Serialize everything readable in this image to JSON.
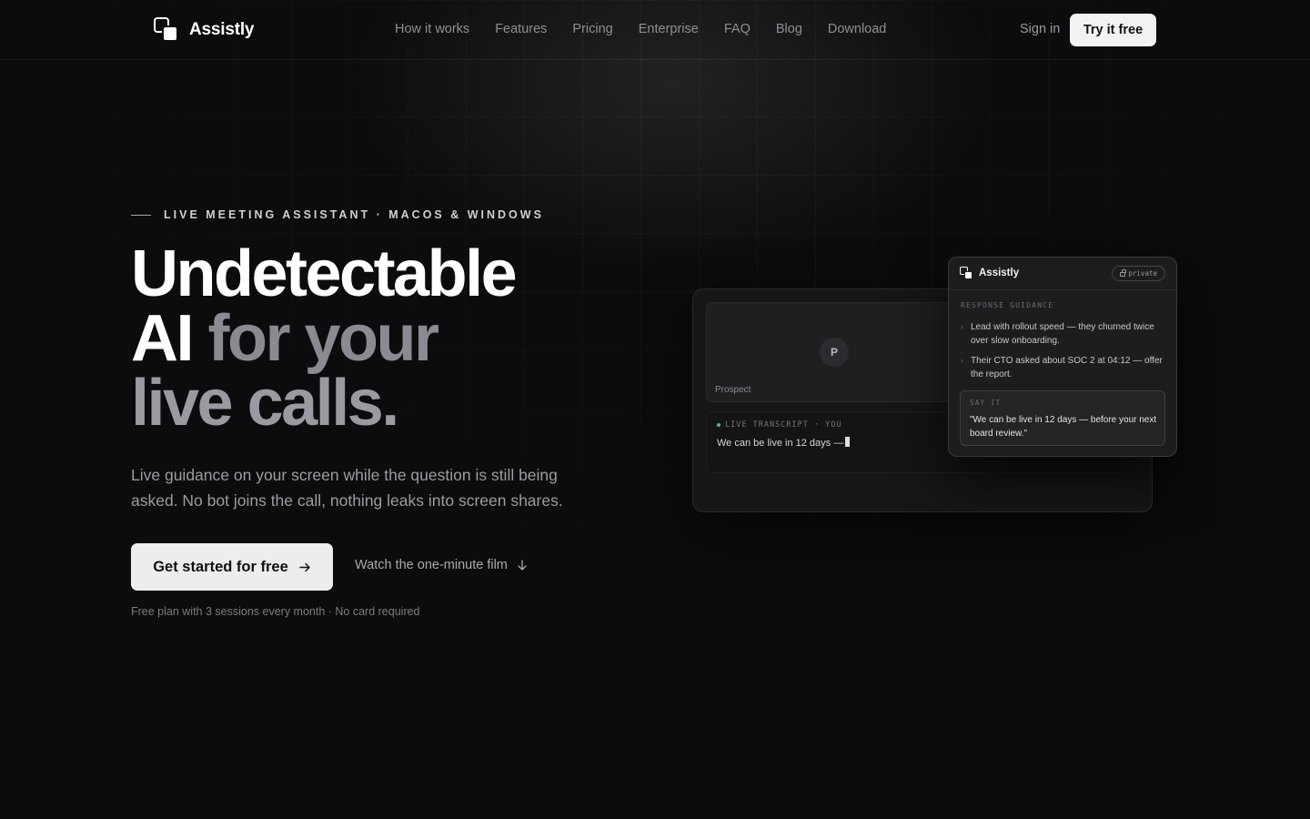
{
  "nav": {
    "brand": "Assistly",
    "links": [
      "How it works",
      "Features",
      "Pricing",
      "Enterprise",
      "FAQ",
      "Blog",
      "Download"
    ],
    "signin": "Sign in",
    "try_free": "Try it free"
  },
  "hero": {
    "eyebrow": "LIVE MEETING ASSISTANT · MACOS & WINDOWS",
    "headline": {
      "line1": "Undetectable",
      "line2a": "AI",
      "line2b": "for your",
      "line3": "live calls."
    },
    "subtitle": "Live guidance on your screen while the question is still being asked. No bot joins the call, nothing leaks into screen shares.",
    "cta_label": "Get started for free",
    "watch_label": "Watch the one-minute film",
    "fine_print": "Free plan with 3 sessions every month · No card required"
  },
  "mockup": {
    "avatar_initial": "P",
    "participant_label": "Prospect",
    "transcript_label": "LIVE TRANSCRIPT · YOU",
    "transcript_text": "We can be live in 12 days —",
    "panel": {
      "brand": "Assistly",
      "badge": "private",
      "section_label": "RESPONSE GUIDANCE",
      "bullets": [
        "Lead with rollout speed — they churned twice over slow onboarding.",
        "Their CTO asked about SOC 2 at 04:12 — offer the report."
      ],
      "say_it_label": "SAY IT",
      "say_it_text": "\"We can be live in 12 days — before your next board review.\""
    }
  },
  "colors": {
    "background": "#0c0c0e",
    "primary_button": "#ededed",
    "muted_text": "#8a8a92",
    "live_dot": "#4fbf7a"
  },
  "icons": {
    "cta": "arrow-right-icon",
    "watch": "arrow-down-icon",
    "badge": "lock-icon",
    "bullet": "chevron-right-icon"
  }
}
